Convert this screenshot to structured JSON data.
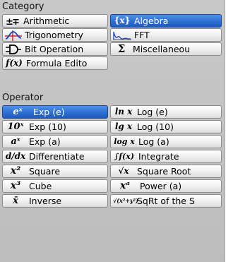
{
  "category": {
    "title": "Category",
    "buttons": [
      {
        "label": "Arithmetic",
        "icon": "plus-minus-icon",
        "glyph": "±",
        "selected": false
      },
      {
        "label": "Algebra",
        "icon": "algebra-braces-icon",
        "glyph": "{x}",
        "selected": true
      },
      {
        "label": "Trigonometry",
        "icon": "sine-wave-icon",
        "glyph": "",
        "selected": false
      },
      {
        "label": "FFT",
        "icon": "fft-spectrum-icon",
        "glyph": "",
        "selected": false
      },
      {
        "label": "Bit Operation",
        "icon": "logic-gate-icon",
        "glyph": "",
        "selected": false
      },
      {
        "label": "Miscellaneou",
        "icon": "sigma-icon",
        "glyph": "Σ",
        "selected": false
      },
      {
        "label": "Formula Edito",
        "icon": "function-fx-icon",
        "glyph": "f(x)",
        "selected": false
      }
    ]
  },
  "operator": {
    "title": "Operator",
    "buttons": [
      {
        "label": "Exp (e)",
        "icon": "exp-e-icon",
        "glyph": "eˣ",
        "selected": true
      },
      {
        "label": "Log (e)",
        "icon": "ln-icon",
        "glyph": "ln x",
        "selected": false
      },
      {
        "label": "Exp (10)",
        "icon": "exp-10-icon",
        "glyph": "10ˣ",
        "selected": false
      },
      {
        "label": "Log (10)",
        "icon": "log10-icon",
        "glyph": "lg x",
        "selected": false
      },
      {
        "label": "Exp (a)",
        "icon": "exp-a-icon",
        "glyph": "aˣ",
        "selected": false
      },
      {
        "label": "Log (a)",
        "icon": "log-a-icon",
        "glyph": "log x",
        "selected": false
      },
      {
        "label": "Differentiate",
        "icon": "derivative-icon",
        "glyph": "d/dx",
        "selected": false
      },
      {
        "label": "Integrate",
        "icon": "integral-icon",
        "glyph": "∫f(x)",
        "selected": false
      },
      {
        "label": "Square",
        "icon": "square-icon",
        "glyph": "x²",
        "selected": false
      },
      {
        "label": "Square Root",
        "icon": "square-root-icon",
        "glyph": "√x",
        "selected": false
      },
      {
        "label": "Cube",
        "icon": "cube-icon",
        "glyph": "x³",
        "selected": false
      },
      {
        "label": "Power (a)",
        "icon": "power-a-icon",
        "glyph": "xᵃ",
        "selected": false
      },
      {
        "label": "Inverse",
        "icon": "inverse-icon",
        "glyph": "x̄",
        "selected": false
      },
      {
        "label": "SqRt of the S",
        "icon": "sqrt-sum-squares-icon",
        "glyph": "√(x²+y²)",
        "selected": false
      }
    ]
  },
  "colors": {
    "panel": "#c4c4c4",
    "selected": "#2f6fd2",
    "button": "#f1f1f1"
  }
}
